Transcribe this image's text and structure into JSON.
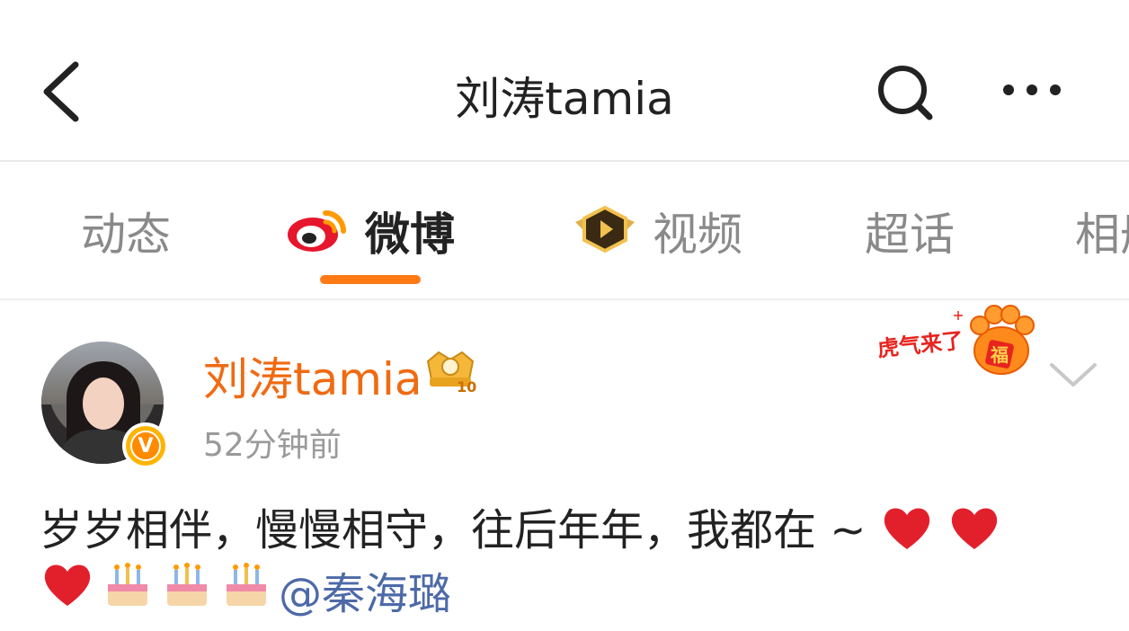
{
  "header": {
    "title": "刘涛tamia",
    "back_icon": "chevron-left-icon",
    "search_icon": "search-icon",
    "more_icon": "more-dots-icon"
  },
  "tabs": [
    {
      "label": "动态",
      "active": false,
      "icon": null
    },
    {
      "label": "微博",
      "active": true,
      "icon": "weibo-logo-icon"
    },
    {
      "label": "视频",
      "active": false,
      "icon": "video-badge-icon"
    },
    {
      "label": "超话",
      "active": false,
      "icon": null
    },
    {
      "label": "相册",
      "active": false,
      "icon": null
    }
  ],
  "post": {
    "author": "刘涛tamia",
    "time": "52分钟前",
    "level_badge": "10",
    "sticker_text": "虎气来了",
    "sticker_char": "福",
    "text_line1": "岁岁相伴，慢慢相守，往后年年，我都在 ~",
    "mention": "@秦海璐"
  },
  "colors": {
    "accent": "#ff7a14",
    "author_name": "#f06a12",
    "mention": "#4d6aa8",
    "divider": "#e9e9e9"
  }
}
